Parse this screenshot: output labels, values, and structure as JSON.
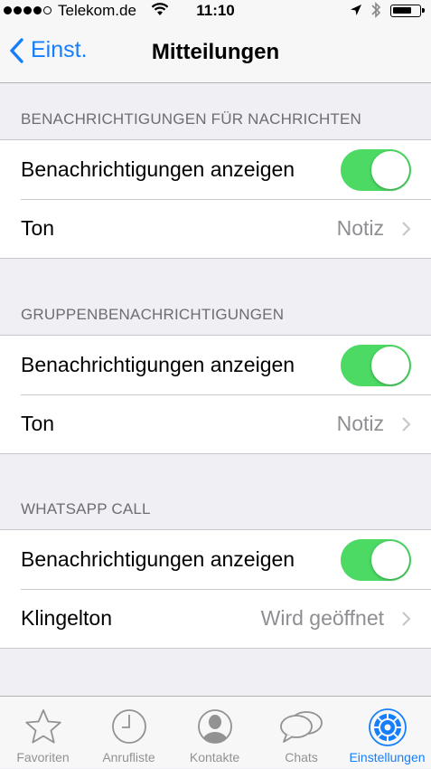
{
  "status_bar": {
    "carrier": "Telekom.de",
    "time": "11:10",
    "signal_bars_filled": 4,
    "signal_bars_total": 5
  },
  "nav": {
    "back_label": "Einst.",
    "title": "Mitteilungen"
  },
  "sections": [
    {
      "header": "BENACHRICHTIGUNGEN FÜR NACHRICHTEN",
      "show_label": "Benachrichtigungen anzeigen",
      "show_enabled": true,
      "sound_label": "Ton",
      "sound_value": "Notiz"
    },
    {
      "header": "GRUPPENBENACHRICHTIGUNGEN",
      "show_label": "Benachrichtigungen anzeigen",
      "show_enabled": true,
      "sound_label": "Ton",
      "sound_value": "Notiz"
    },
    {
      "header": "WHATSAPP CALL",
      "show_label": "Benachrichtigungen anzeigen",
      "show_enabled": true,
      "sound_label": "Klingelton",
      "sound_value": "Wird geöffnet"
    }
  ],
  "tabs": [
    {
      "label": "Favoriten",
      "icon": "star-icon"
    },
    {
      "label": "Anrufliste",
      "icon": "clock-icon"
    },
    {
      "label": "Kontakte",
      "icon": "contact-icon"
    },
    {
      "label": "Chats",
      "icon": "chat-bubbles-icon"
    },
    {
      "label": "Einstellungen",
      "icon": "gear-icon",
      "active": true
    }
  ],
  "colors": {
    "accent": "#157efb",
    "toggle_on": "#4cd964",
    "background": "#efeff4",
    "secondary_text": "#8e8e93"
  }
}
